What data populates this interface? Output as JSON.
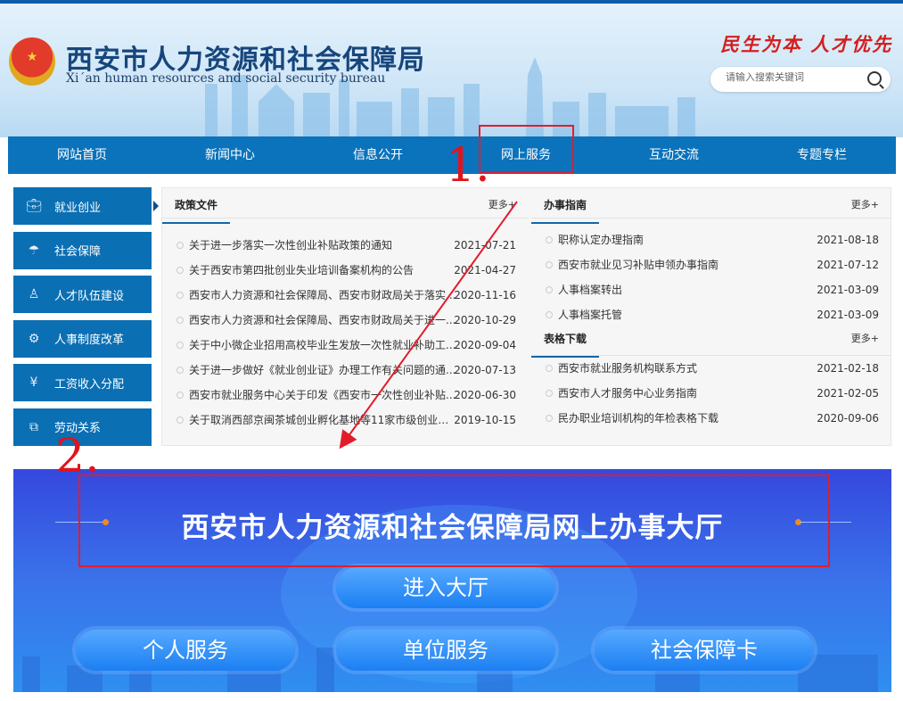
{
  "header": {
    "title": "西安市人力资源和社会保障局",
    "subtitle": "Xi´an human resources and social security bureau",
    "slogan": "民生为本 人才优先",
    "search_placeholder": "请输入搜索关键词"
  },
  "nav": [
    "网站首页",
    "新闻中心",
    "信息公开",
    "网上服务",
    "互动交流",
    "专题专栏"
  ],
  "sidebar": [
    {
      "label": "就业创业",
      "icon": "briefcase-icon"
    },
    {
      "label": "社会保障",
      "icon": "umbrella-icon"
    },
    {
      "label": "人才队伍建设",
      "icon": "person-icon"
    },
    {
      "label": "人事制度改革",
      "icon": "gear-icon"
    },
    {
      "label": "工资收入分配",
      "icon": "yen-icon"
    },
    {
      "label": "劳动关系",
      "icon": "copy-icon"
    }
  ],
  "policy": {
    "title": "政策文件",
    "more": "更多+",
    "items": [
      {
        "title": "关于进一步落实一次性创业补贴政策的通知",
        "date": "2021-07-21"
      },
      {
        "title": "关于西安市第四批创业失业培训备案机构的公告",
        "date": "2021-04-27"
      },
      {
        "title": "西安市人力资源和社会保障局、西安市财政局关于落实...",
        "date": "2020-11-16"
      },
      {
        "title": "西安市人力资源和社会保障局、西安市财政局关于进一...",
        "date": "2020-10-29"
      },
      {
        "title": "关于中小微企业招用高校毕业生发放一次性就业补助工...",
        "date": "2020-09-04"
      },
      {
        "title": "关于进一步做好《就业创业证》办理工作有关问题的通...",
        "date": "2020-07-13"
      },
      {
        "title": "西安市就业服务中心关于印发《西安市一次性创业补贴...",
        "date": "2020-06-30"
      },
      {
        "title": "关于取消西部京闽茶城创业孵化基地等11家市级创业孵...",
        "date": "2019-10-15"
      }
    ]
  },
  "guide": {
    "title": "办事指南",
    "more": "更多+",
    "items": [
      {
        "title": "职称认定办理指南",
        "date": "2021-08-18"
      },
      {
        "title": "西安市就业见习补贴申领办事指南",
        "date": "2021-07-12"
      },
      {
        "title": "人事档案转出",
        "date": "2021-03-09"
      },
      {
        "title": "人事档案托管",
        "date": "2021-03-09"
      }
    ]
  },
  "forms": {
    "title": "表格下载",
    "more": "更多+",
    "items": [
      {
        "title": "西安市就业服务机构联系方式",
        "date": "2021-02-18"
      },
      {
        "title": "西安市人才服务中心业务指南",
        "date": "2021-02-05"
      },
      {
        "title": "民办职业培训机构的年检表格下载",
        "date": "2020-09-06"
      }
    ]
  },
  "banner": {
    "title": "西安市人力资源和社会保障局网上办事大厅",
    "enter": "进入大厅",
    "buttons": [
      "个人服务",
      "单位服务",
      "社会保障卡"
    ]
  },
  "annotations": [
    "1.",
    "2."
  ],
  "colors": {
    "nav": "#0b73bb",
    "annotation": "#e21d2a"
  }
}
